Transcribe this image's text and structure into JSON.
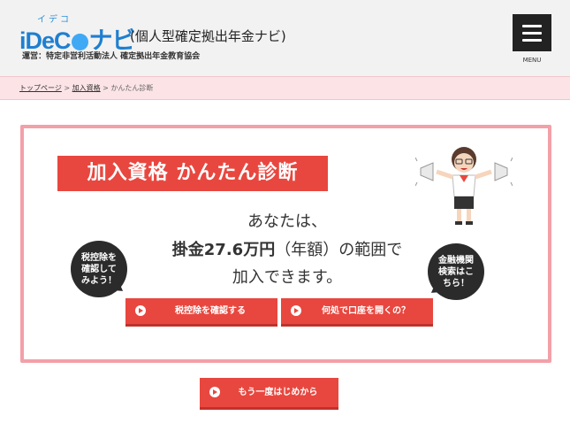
{
  "header": {
    "logo_ruby": "イデコ",
    "logo_parts": {
      "i": "i",
      "d": "D",
      "e": "e",
      "c": "C",
      "navi": "ナビ"
    },
    "logo_subtitle": "(個人型確定拠出年金ナビ)",
    "organization": "運営：特定非営利活動法人 確定拠出年金教育協会",
    "menu_label": "MENU"
  },
  "breadcrumb": {
    "home": "トップページ",
    "separator1": " > ",
    "parent": "加入資格",
    "separator2": " > ",
    "current": "かんたん診断"
  },
  "card": {
    "title": "加入資格 かんたん診断",
    "line1": "あなたは、",
    "line2_bold": "掛金27.6万円",
    "line2_rest": "（年額）の範囲で",
    "line3": "加入できます。",
    "bubble_left": [
      "税控除を",
      "確認して",
      "みよう！"
    ],
    "bubble_right": [
      "金融機関",
      "検索はこ",
      "ちら！"
    ],
    "button_tax": "税控除を確認する",
    "button_where": "何処で口座を開くの？"
  },
  "restart_button": "もう一度はじめから",
  "colors": {
    "accent": "#e8473f",
    "card_border": "#f3a0a8",
    "breadcrumb_bg": "#fbe3e6",
    "logo_blue": "#1f7fd0"
  },
  "icons": {
    "menu": "hamburger-icon",
    "button_arrow": "circle-arrow-right-icon",
    "illustration": "woman-megaphones-illustration"
  }
}
